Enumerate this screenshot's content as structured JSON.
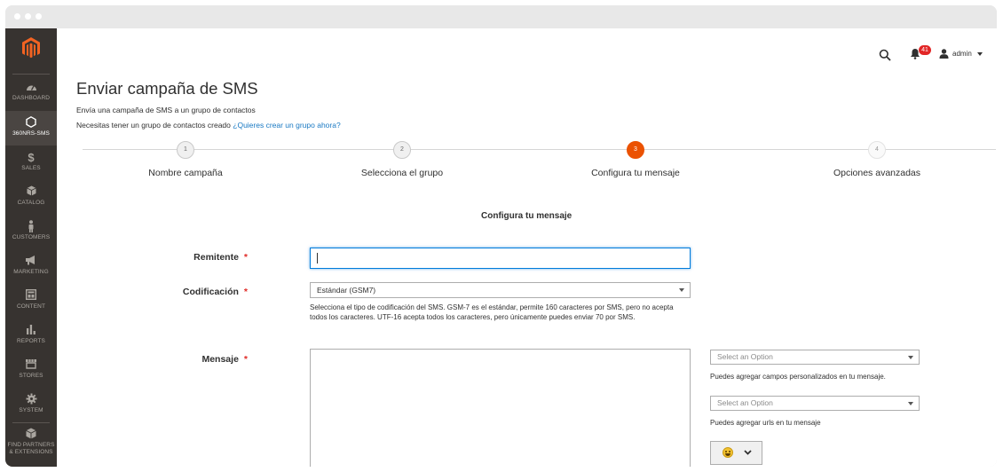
{
  "sidebar": {
    "items": [
      {
        "label": "DASHBOARD",
        "icon": "dashboard-icon"
      },
      {
        "label": "360NRS-SMS",
        "icon": "hexagon-icon",
        "active": true
      },
      {
        "label": "SALES",
        "icon": "dollar-icon"
      },
      {
        "label": "CATALOG",
        "icon": "box-icon"
      },
      {
        "label": "CUSTOMERS",
        "icon": "person-icon"
      },
      {
        "label": "MARKETING",
        "icon": "megaphone-icon"
      },
      {
        "label": "CONTENT",
        "icon": "layout-icon"
      },
      {
        "label": "REPORTS",
        "icon": "bar-chart-icon"
      },
      {
        "label": "STORES",
        "icon": "store-icon"
      },
      {
        "label": "SYSTEM",
        "icon": "gear-icon"
      },
      {
        "label": "FIND PARTNERS & EXTENSIONS",
        "icon": "cube-icon"
      }
    ]
  },
  "header": {
    "user": "admin",
    "notifications": "41"
  },
  "page": {
    "title": "Enviar campaña de SMS",
    "intro1": "Envía una campaña de SMS a un grupo de contactos",
    "intro2": "Necesitas tener un grupo de contactos creado",
    "intro2_link": "¿Quieres crear un grupo ahora?"
  },
  "steps": [
    {
      "num": "1",
      "label": "Nombre campaña"
    },
    {
      "num": "2",
      "label": "Selecciona el grupo"
    },
    {
      "num": "3",
      "label": "Configura tu mensaje"
    },
    {
      "num": "4",
      "label": "Opciones avanzadas"
    }
  ],
  "form": {
    "section_title": "Configura tu mensaje",
    "sender_label": "Remitente",
    "sender_value": "",
    "encoding_label": "Codificación",
    "encoding_value": "Estándar (GSM7)",
    "encoding_note": "Selecciona el tipo de codificación del SMS. GSM-7 es el estándar, permite 160 caracteres por SMS, pero no acepta todos los caracteres. UTF-16 acepta todos los caracteres, pero únicamente puedes enviar 70 por SMS.",
    "message_label": "Mensaje",
    "custom_fields_select": "Select an Option",
    "custom_fields_note": "Puedes agregar campos personalizados en tu mensaje.",
    "urls_select": "Select an Option",
    "urls_note": "Puedes agregar urls en tu mensaje",
    "required_mark": "*"
  },
  "colors": {
    "sidebar": "#373330",
    "accent": "#eb5202",
    "link": "#1979c3",
    "required": "#e02b27"
  }
}
